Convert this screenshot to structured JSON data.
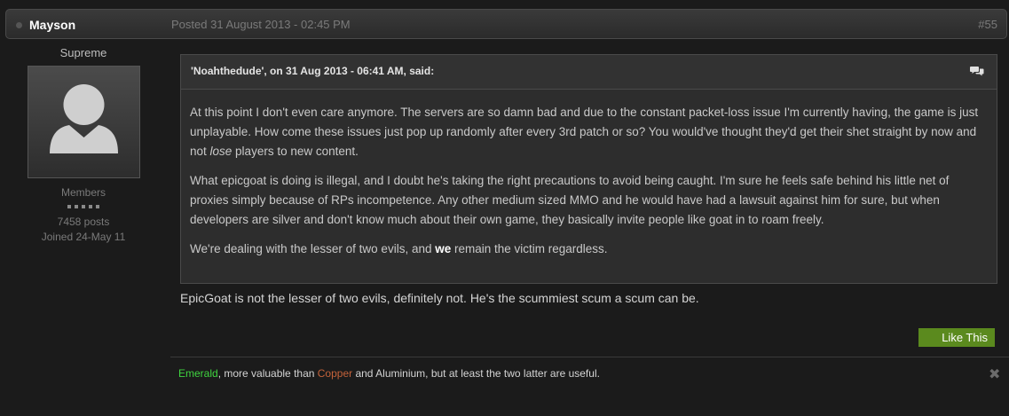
{
  "post": {
    "author": "Mayson",
    "date": "Posted 31 August 2013 - 02:45 PM",
    "number": "#55"
  },
  "author_panel": {
    "rank": "Supreme",
    "group": "Members",
    "posts": "7458 posts",
    "joined": "Joined 24-May 11"
  },
  "quote": {
    "citation": "'Noahthedude', on 31 Aug 2013 - 06:41 AM, said:",
    "p1_a": "At this point I don't even care anymore. The servers are so damn bad and due to the constant packet-loss issue I'm currently having, the game is just unplayable. How come these issues just pop up randomly after every 3rd patch or so? You would've thought they'd get their shet straight by now and not ",
    "p1_em": "lose",
    "p1_b": " players to new content.",
    "p2": "What epicgoat is doing is illegal, and I doubt he's taking the right precautions to avoid being caught. I'm sure he feels safe behind his little net of proxies simply because of RPs incompetence. Any other medium sized MMO and he would have had a lawsuit against him for sure, but when developers are silver and don't know much about their own game, they basically invite people like goat in to roam freely.",
    "p3_a": "We're dealing with the lesser of two evils, and ",
    "p3_bold": "we",
    "p3_b": " remain the victim regardless."
  },
  "body": "EpicGoat is not the lesser of two evils, definitely not. He's the scummiest scum a scum can be.",
  "like_label": "Like This",
  "signature": {
    "emerald": "Emerald",
    "part1": ", more valuable than ",
    "copper": "Copper",
    "part2": " and Aluminium, but at least the two latter are useful."
  },
  "close_glyph": "✖",
  "colors": {
    "emerald": "#3fd43f",
    "copper": "#c4623a",
    "like_button": "#5b8a1e"
  }
}
